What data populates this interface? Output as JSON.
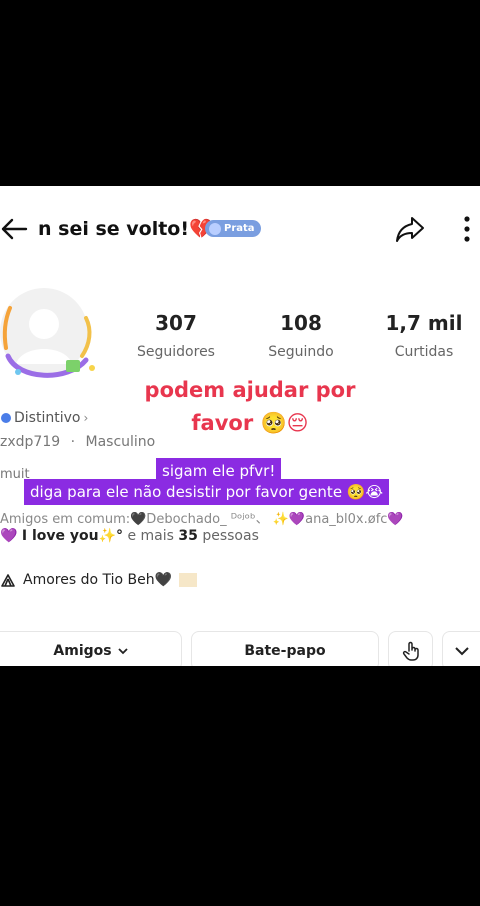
{
  "header": {
    "title": "n sei se volto!💔",
    "badge": "Prata"
  },
  "stats": [
    {
      "value": "307",
      "label": "Seguidores"
    },
    {
      "value": "108",
      "label": "Seguindo"
    },
    {
      "value": "1,7 mil",
      "label": "Curtidas"
    }
  ],
  "overlay_text": "podem ajudar por favor 🥺😔",
  "profile": {
    "distintivo": "Distintivo",
    "username": "zxdp719",
    "separator": "·",
    "gender": "Masculino",
    "bio_partial": "muit",
    "amigos_em_comum": "Amigos em comum:🖤Debochado_ ᴰᵒʲᵒᵇ、 ✨💜ana_bl0x.øfc💜",
    "i_love_you": "I love you✨°",
    "e_mais": "e mais",
    "count": "35",
    "pessoas": "pessoas",
    "group": "Amores do Tio Beh🖤"
  },
  "captions": {
    "line1": "sigam ele pfvr!",
    "line2": "diga para ele não desistir por favor gente 🥺😭"
  },
  "actions": {
    "amigos": "Amigos",
    "bate_papo": "Bate-papo"
  }
}
